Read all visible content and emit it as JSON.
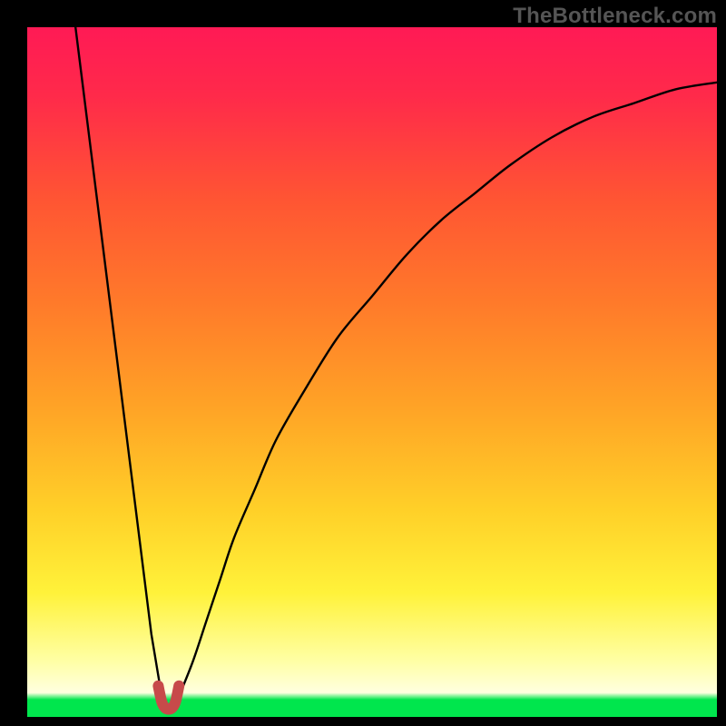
{
  "watermark": "TheBottleneck.com",
  "chart_data": {
    "type": "line",
    "title": "",
    "xlabel": "",
    "ylabel": "",
    "xlim": [
      0,
      100
    ],
    "ylim": [
      0,
      100
    ],
    "grid": false,
    "legend": false,
    "series": [
      {
        "name": "left-branch",
        "x": [
          7,
          8,
          9,
          10,
          11,
          12,
          13,
          14,
          15,
          16,
          17,
          18,
          19,
          19.5
        ],
        "values": [
          100,
          92,
          84,
          76,
          68,
          60,
          52,
          44,
          36,
          28,
          20,
          12,
          6,
          3
        ]
      },
      {
        "name": "right-branch",
        "x": [
          22,
          24,
          26,
          28,
          30,
          33,
          36,
          40,
          45,
          50,
          55,
          60,
          65,
          70,
          76,
          82,
          88,
          94,
          100
        ],
        "values": [
          3,
          8,
          14,
          20,
          26,
          33,
          40,
          47,
          55,
          61,
          67,
          72,
          76,
          80,
          84,
          87,
          89,
          91,
          92
        ]
      },
      {
        "name": "cusp-segment",
        "stroke": "#c74a4a",
        "stroke_width": 12,
        "x": [
          19,
          19.5,
          20,
          20.5,
          21,
          21.5,
          22
        ],
        "values": [
          4.5,
          2.2,
          1.3,
          1.1,
          1.3,
          2.2,
          4.5
        ]
      }
    ],
    "annotations": []
  }
}
